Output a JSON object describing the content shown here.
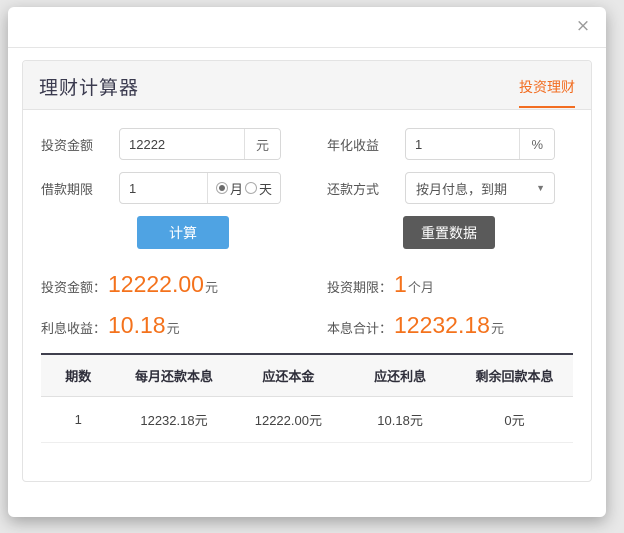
{
  "modal": {
    "close_icon_label": "×"
  },
  "card": {
    "title": "理财计算器",
    "tab_label": "投资理财"
  },
  "form": {
    "amount": {
      "label": "投资金额",
      "value": "12222",
      "placeholder": "请输入投资金额",
      "unit": "元"
    },
    "rate": {
      "label": "年化收益",
      "value": "1",
      "placeholder": "请输入年化收益",
      "unit": "%"
    },
    "term": {
      "label": "借款期限",
      "value": "1",
      "placeholder": "请输入借款期限",
      "options": [
        {
          "label": "月",
          "checked": true
        },
        {
          "label": "天",
          "checked": false
        }
      ]
    },
    "repayment": {
      "label": "还款方式",
      "selected": "按月付息，到期",
      "arrow_icon": "▼"
    }
  },
  "buttons": {
    "calculate": "计算",
    "reset": "重置数据"
  },
  "results": [
    {
      "label": "投资金额：",
      "value": "12222.00",
      "unit": "元"
    },
    {
      "label": "投资期限：",
      "value": "1",
      "unit": "个月"
    },
    {
      "label": "利息收益：",
      "value": "10.18",
      "unit": "元"
    },
    {
      "label": "本息合计：",
      "value": "12232.18",
      "unit": "元"
    }
  ],
  "table": {
    "headers": [
      "期数",
      "每月还款本息",
      "应还本金",
      "应还利息",
      "剩余回款本息"
    ],
    "rows": [
      [
        "1",
        "12232.18元",
        "12222.00元",
        "10.18元",
        "0元"
      ]
    ]
  }
}
